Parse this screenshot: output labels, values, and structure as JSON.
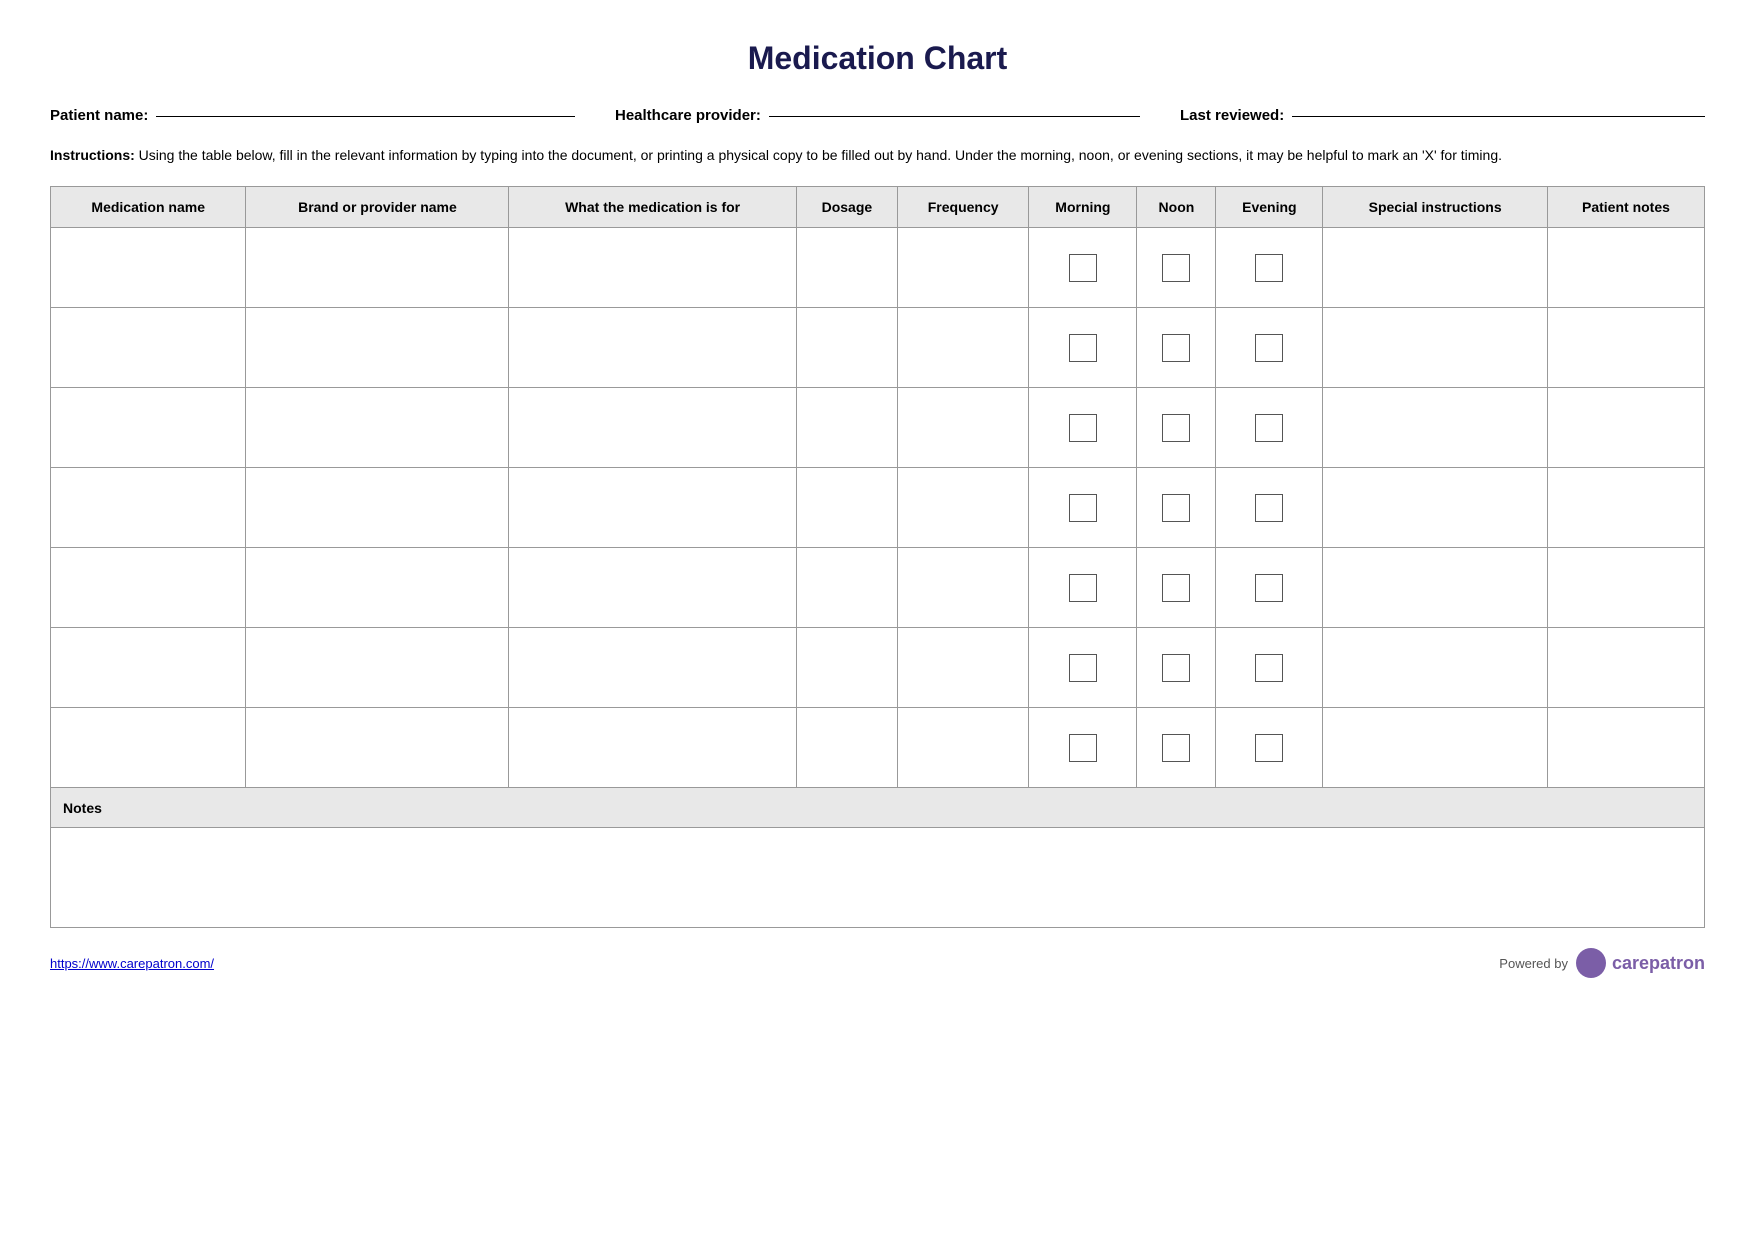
{
  "page": {
    "title": "Medication Chart"
  },
  "patient_info": {
    "patient_name_label": "Patient name:",
    "healthcare_provider_label": "Healthcare provider:",
    "last_reviewed_label": "Last reviewed:"
  },
  "instructions": {
    "label": "Instructions:",
    "text": "Using the table below, fill in the relevant information by typing into the document, or printing a physical copy to be filled out by hand. Under the morning, noon, or evening sections, it may be helpful to mark an 'X' for timing."
  },
  "table": {
    "headers": [
      "Medication name",
      "Brand or provider name",
      "What the medication is for",
      "Dosage",
      "Frequency",
      "Morning",
      "Noon",
      "Evening",
      "Special instructions",
      "Patient notes"
    ],
    "rows": 7
  },
  "notes_section": {
    "label": "Notes"
  },
  "footer": {
    "link_text": "https://www.carepatron.com/",
    "powered_by": "Powered by",
    "brand_name": "care",
    "brand_suffix": "patron"
  }
}
